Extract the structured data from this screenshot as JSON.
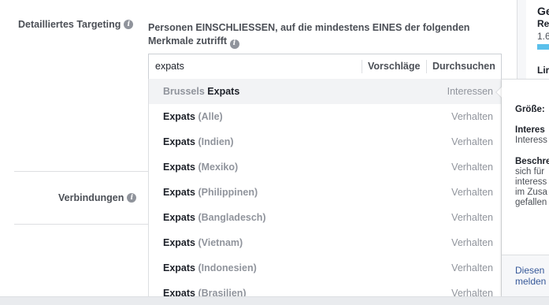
{
  "targeting": {
    "label": "Detailliertes Targeting",
    "description": "Personen EINSCHLIESSEN, auf die mindestens EINES der folgenden Merkmale zutrifft",
    "search_value": "expats",
    "tab_suggestions": "Vorschläge",
    "tab_browse": "Durchsuchen"
  },
  "connections": {
    "label": "Verbindungen"
  },
  "dropdown": {
    "items": [
      {
        "muted_prefix": "Brussels ",
        "name": "Expats",
        "suffix": "",
        "type": "Interessen"
      },
      {
        "muted_prefix": "",
        "name": "Expats ",
        "suffix": "(Alle)",
        "type": "Verhalten"
      },
      {
        "muted_prefix": "",
        "name": "Expats ",
        "suffix": "(Indien)",
        "type": "Verhalten"
      },
      {
        "muted_prefix": "",
        "name": "Expats ",
        "suffix": "(Mexiko)",
        "type": "Verhalten"
      },
      {
        "muted_prefix": "",
        "name": "Expats ",
        "suffix": "(Philippinen)",
        "type": "Verhalten"
      },
      {
        "muted_prefix": "",
        "name": "Expats ",
        "suffix": "(Bangladesch)",
        "type": "Verhalten"
      },
      {
        "muted_prefix": "",
        "name": "Expats ",
        "suffix": "(Vietnam)",
        "type": "Verhalten"
      },
      {
        "muted_prefix": "",
        "name": "Expats ",
        "suffix": "(Indonesien)",
        "type": "Verhalten"
      },
      {
        "muted_prefix": "",
        "name": "Expats ",
        "suffix": "(Brasilien)",
        "type": "Verhalten"
      }
    ]
  },
  "hover_card": {
    "size_label": "Größe:",
    "interest_label": "Interes",
    "interest_value": "Interess",
    "desc_label": "Beschre",
    "desc_lines": [
      "sich für",
      "interess",
      "im Zusa",
      "gefallen"
    ],
    "footer_line1": "Diesen",
    "footer_line2": "melden"
  },
  "right_panel": {
    "title": "Ge",
    "sub": "Re",
    "num": "1.6",
    "li": "Lir"
  },
  "colors": {
    "accent": "#4267b2",
    "link": "#365899",
    "muted": "#90949c",
    "bar": "#5bc0eb"
  }
}
